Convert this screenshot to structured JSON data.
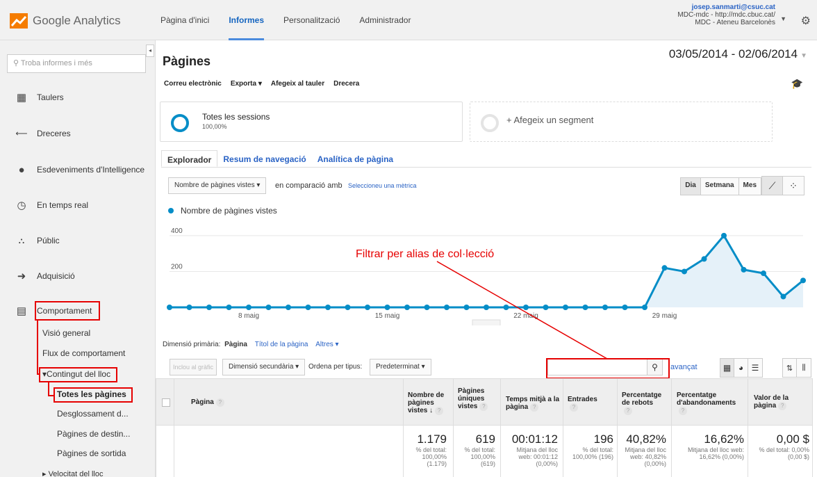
{
  "header": {
    "logo_text": "Google Analytics",
    "nav": [
      "Pàgina d'inici",
      "Informes",
      "Personalització",
      "Administrador"
    ],
    "active_nav": "Informes",
    "account_email": "josep.sanmarti@csuc.cat",
    "account_property": "MDC-mdc - http://mdc.cbuc.cat/",
    "account_view": "MDC - Ateneu Barcelonès"
  },
  "sidebar": {
    "search_placeholder": "Troba informes i més",
    "items": [
      {
        "label": "Taulers",
        "icon": "grid-icon"
      },
      {
        "label": "Dreceres",
        "icon": "shortcut-arrow-icon"
      },
      {
        "label": "Esdeveniments d'Intelligence",
        "icon": "lightbulb-icon"
      },
      {
        "label": "En temps real",
        "icon": "clock-icon"
      },
      {
        "label": "Públic",
        "icon": "people-icon"
      },
      {
        "label": "Adquisició",
        "icon": "acquisition-icon"
      },
      {
        "label": "Comportament",
        "icon": "behavior-icon"
      }
    ],
    "behavior_sub": [
      "Visió general",
      "Flux de comportament",
      "Contingut del lloc"
    ],
    "content_sub": [
      "Totes les pàgines",
      "Desglossament d...",
      "Pàgines de destin...",
      "Pàgines de sortida"
    ],
    "site_speed": "Velocitat del lloc"
  },
  "main": {
    "title": "Pàgines",
    "date_range": "03/05/2014 - 02/06/2014",
    "toolbar": [
      "Correu electrònic",
      "Exporta ▾",
      "Afegeix al tauler",
      "Drecera"
    ],
    "segment_all": "Totes les sessions",
    "segment_all_pct": "100,00%",
    "segment_add": "+ Afegeix un segment",
    "tabs": [
      "Explorador",
      "Resum de navegació",
      "Analítica de pàgina"
    ],
    "metric_select": "Nombre de pàgines vistes",
    "compare_text": "en comparació amb",
    "compare_link": "Seleccioneu una mètrica",
    "granularity": [
      "Dia",
      "Setmana",
      "Mes"
    ],
    "legend": "Nombre de pàgines vistes",
    "annotation": "Filtrar per alias de col·lecció",
    "dim_label": "Dimensió primària:",
    "dim_active": "Pàgina",
    "dim_links": [
      "Títol de la pàgina",
      "Altres ▾"
    ],
    "plot_rows_btn": "Inclou al gràfic",
    "secondary_dim": "Dimensió secundària",
    "sort_label": "Ordena per tipus:",
    "sort_value": "Predeterminat",
    "advanced": "avançat"
  },
  "chart_data": {
    "type": "area",
    "series": [
      {
        "name": "Nombre de pàgines vistes",
        "values": [
          0,
          0,
          0,
          0,
          0,
          0,
          0,
          0,
          0,
          0,
          0,
          0,
          0,
          0,
          0,
          0,
          0,
          0,
          0,
          0,
          0,
          0,
          0,
          0,
          0,
          220,
          200,
          270,
          400,
          210,
          190,
          60,
          150
        ]
      }
    ],
    "ylim": [
      0,
      450
    ],
    "y_ticks": [
      200,
      400
    ],
    "x_labels": [
      {
        "index": 4,
        "label": "8 maig"
      },
      {
        "index": 11,
        "label": "15 maig"
      },
      {
        "index": 18,
        "label": "22 maig"
      },
      {
        "index": 25,
        "label": "29 maig"
      }
    ],
    "color": "#058dc7"
  },
  "table": {
    "headers": [
      "Pàgina",
      "Nombre de pàgines vistes",
      "Pàgines úniques vistes",
      "Temps mitjà a la pàgina",
      "Entrades",
      "Percentatge de rebots",
      "Percentatge d'abandonaments",
      "Valor de la pàgina"
    ],
    "totals": [
      {
        "value": "1.179",
        "sub": "% del total: 100,00% (1.179)"
      },
      {
        "value": "619",
        "sub": "% del total: 100,00% (619)"
      },
      {
        "value": "00:01:12",
        "sub": "Mitjana del lloc web: 00:01:12 (0,00%)"
      },
      {
        "value": "196",
        "sub": "% del total: 100,00% (196)"
      },
      {
        "value": "40,82%",
        "sub": "Mitjana del lloc web: 40,82% (0,00%)"
      },
      {
        "value": "16,62%",
        "sub": "Mitjana del lloc web: 16,62% (0,00%)"
      },
      {
        "value": "0,00 $",
        "sub": "% del total: 0,00% (0,00 $)"
      }
    ]
  }
}
